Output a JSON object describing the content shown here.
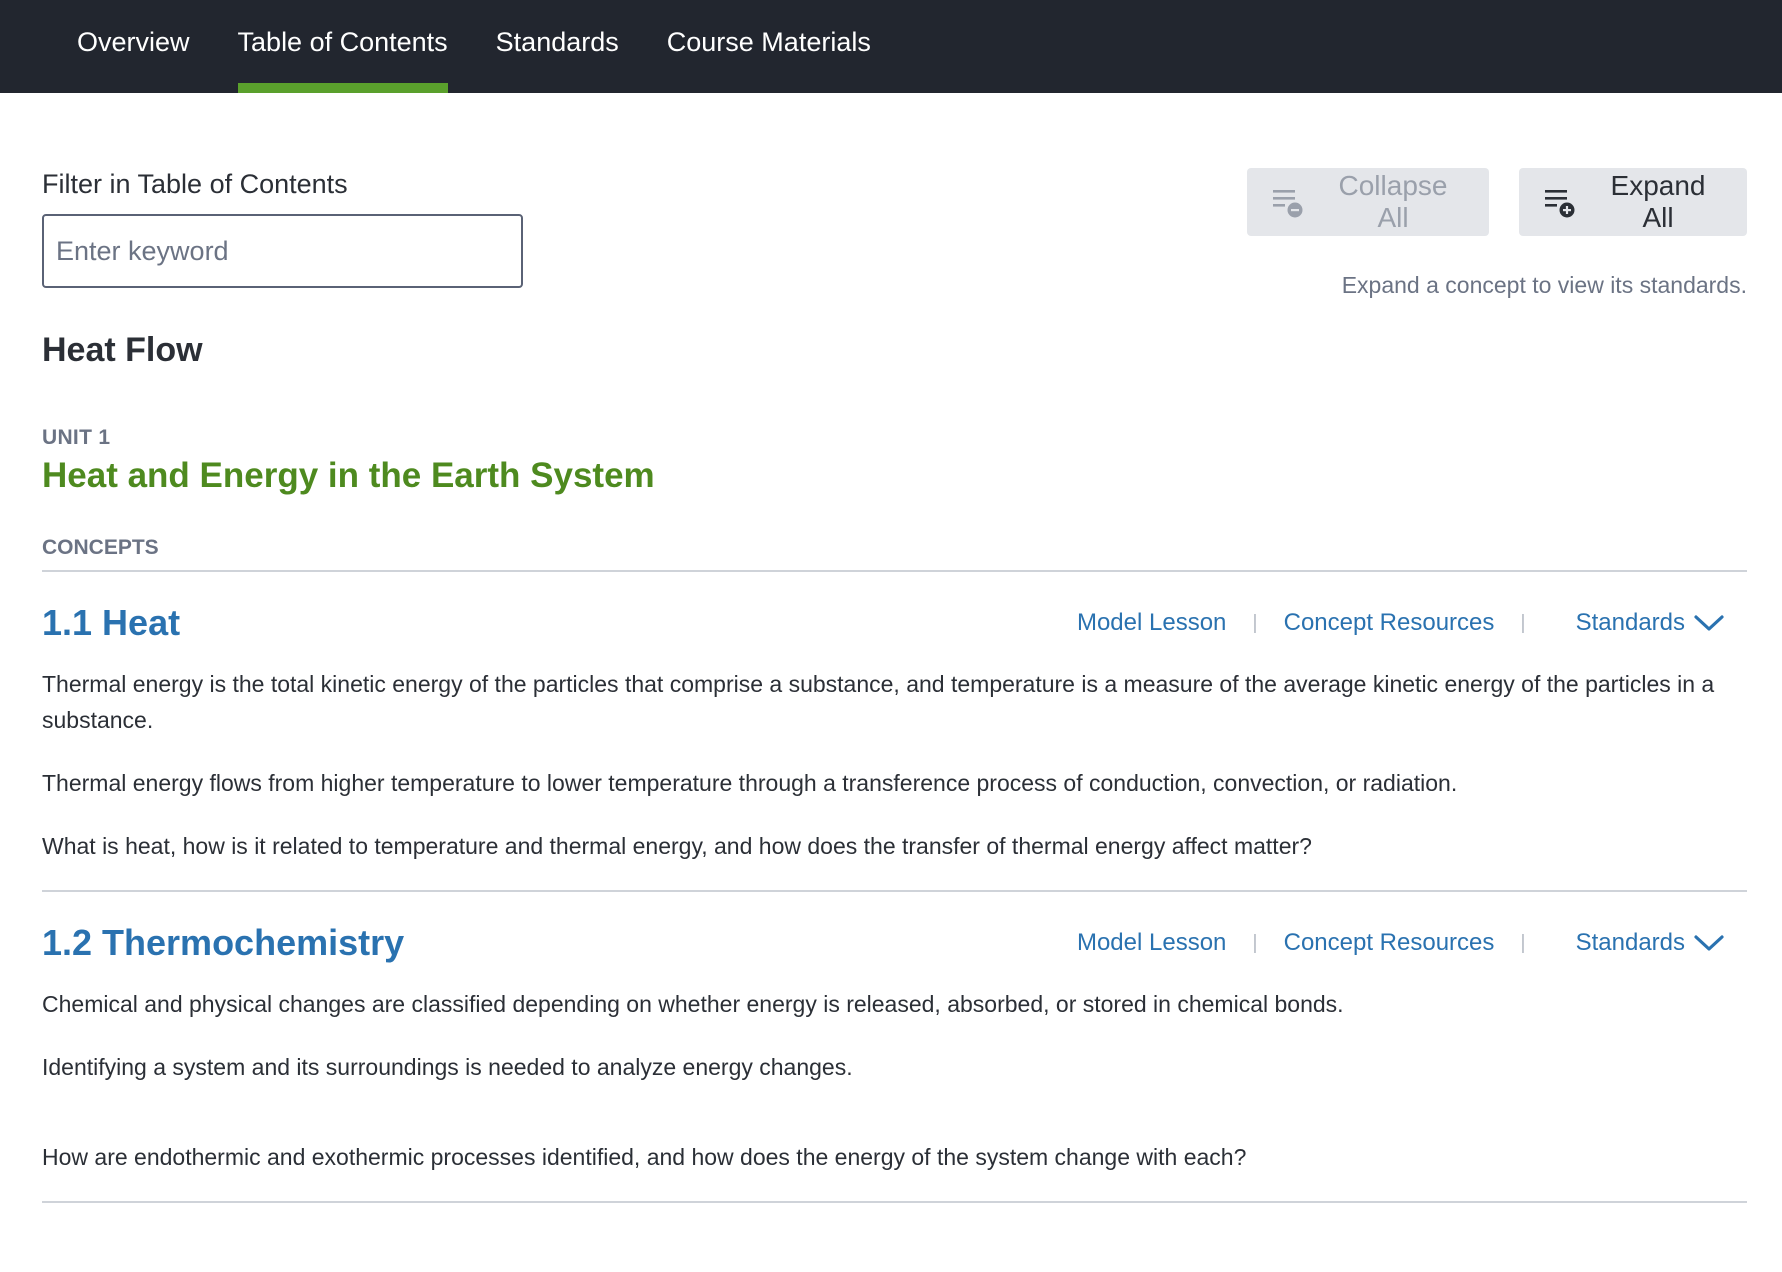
{
  "nav": {
    "tabs": [
      {
        "label": "Overview"
      },
      {
        "label": "Table of Contents"
      },
      {
        "label": "Standards"
      },
      {
        "label": "Course Materials"
      }
    ],
    "active_tab": "Table of Contents"
  },
  "filter": {
    "label": "Filter in Table of Contents",
    "placeholder": "Enter keyword",
    "value": ""
  },
  "toolbar": {
    "collapse_label": "Collapse All",
    "expand_label": "Expand All",
    "hint": "Expand a concept to view its standards."
  },
  "course": {
    "title": "Heat Flow"
  },
  "unit": {
    "label": "UNIT 1",
    "title": "Heat and Energy in the Earth System",
    "concepts_label": "CONCEPTS"
  },
  "concepts": [
    {
      "title": "1.1 Heat",
      "model_lesson": "Model Lesson",
      "resources": "Concept Resources",
      "standards": "Standards",
      "paragraphs": [
        "Thermal energy is the total kinetic energy of the particles that comprise a substance, and temperature is a measure of the average kinetic energy of the particles in a substance.",
        "Thermal energy flows from higher temperature to lower temperature through a  transference process of conduction, convection, or radiation.",
        "What is heat, how is it related to temperature and thermal energy, and how does the transfer of thermal energy affect matter?"
      ]
    },
    {
      "title": "1.2 Thermochemistry",
      "model_lesson": "Model Lesson",
      "resources": "Concept Resources",
      "standards": "Standards",
      "paragraphs": [
        "Chemical and physical changes are classified depending on whether energy is released, absorbed, or stored in chemical bonds.",
        "Identifying a system and its surroundings is needed to analyze energy changes.",
        "How are endothermic and exothermic processes identified, and how does the energy of the system change with each?"
      ]
    }
  ],
  "colors": {
    "nav_bg": "#22262f",
    "active_underline": "#5aa02c",
    "unit_title": "#4e8a1f",
    "link": "#2a72b0"
  }
}
